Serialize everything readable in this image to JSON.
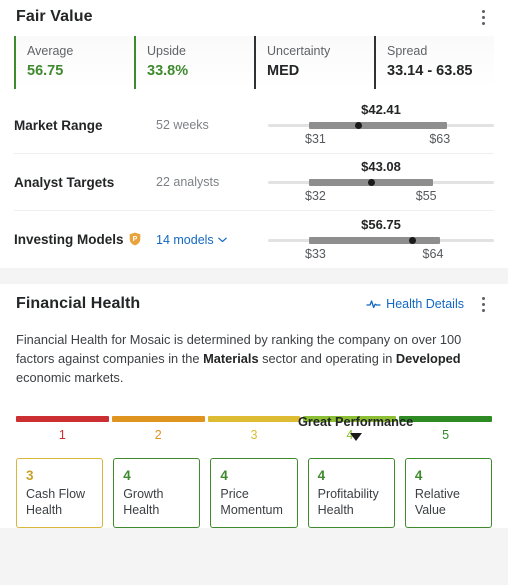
{
  "fair_value": {
    "title": "Fair Value",
    "menu_icon": "kebab-menu-icon",
    "stats": [
      {
        "label": "Average",
        "value": "56.75",
        "accent": "#3f8a2e"
      },
      {
        "label": "Upside",
        "value": "33.8%",
        "accent": "#3f8a2e"
      },
      {
        "label": "Uncertainty",
        "value": "MED",
        "accent": "#2f3234"
      },
      {
        "label": "Spread",
        "value": "33.14 - 63.85",
        "accent": "#2f3234"
      }
    ],
    "rows": [
      {
        "name": "Market Range",
        "meta": "52 weeks",
        "meta_is_link": false,
        "has_pro_badge": false,
        "marker_value": "$42.41",
        "low": "$31",
        "high": "$63",
        "fill_start_pct": 18,
        "fill_end_pct": 79,
        "marker_pct": 40
      },
      {
        "name": "Analyst Targets",
        "meta": "22 analysts",
        "meta_is_link": false,
        "has_pro_badge": false,
        "marker_value": "$43.08",
        "low": "$32",
        "high": "$55",
        "fill_start_pct": 18,
        "fill_end_pct": 73,
        "marker_pct": 46
      },
      {
        "name": "Investing Models",
        "meta": "14 models",
        "meta_is_link": true,
        "has_pro_badge": true,
        "marker_value": "$56.75",
        "low": "$33",
        "high": "$64",
        "fill_start_pct": 18,
        "fill_end_pct": 76,
        "marker_pct": 64
      }
    ]
  },
  "financial_health": {
    "title": "Financial Health",
    "details_link": "Health Details",
    "details_icon": "pulse-icon",
    "menu_icon": "kebab-menu-icon",
    "description": {
      "part1": "Financial Health for Mosaic is determined by ranking the company on over 100 factors against companies in the ",
      "bold1": "Materials",
      "part2": " sector and operating in ",
      "bold2": "Developed",
      "part3": " economic markets."
    },
    "scale": {
      "caption": "Great Performance",
      "marker_pct": 70,
      "segments": [
        {
          "label": "1",
          "color": "#cc2f32"
        },
        {
          "label": "2",
          "color": "#e09420"
        },
        {
          "label": "3",
          "color": "#ddbb33"
        },
        {
          "label": "4",
          "color": "#8cbf33"
        },
        {
          "label": "5",
          "color": "#2e8b23"
        }
      ]
    },
    "scores": [
      {
        "value": "3",
        "label": "Cash Flow Health",
        "color": "#c9a227"
      },
      {
        "value": "4",
        "label": "Growth Health",
        "color": "#3f8a2e"
      },
      {
        "value": "4",
        "label": "Price Momentum",
        "color": "#3f8a2e"
      },
      {
        "value": "4",
        "label": "Profitability Health",
        "color": "#3f8a2e"
      },
      {
        "value": "4",
        "label": "Relative Value",
        "color": "#3f8a2e"
      }
    ]
  }
}
